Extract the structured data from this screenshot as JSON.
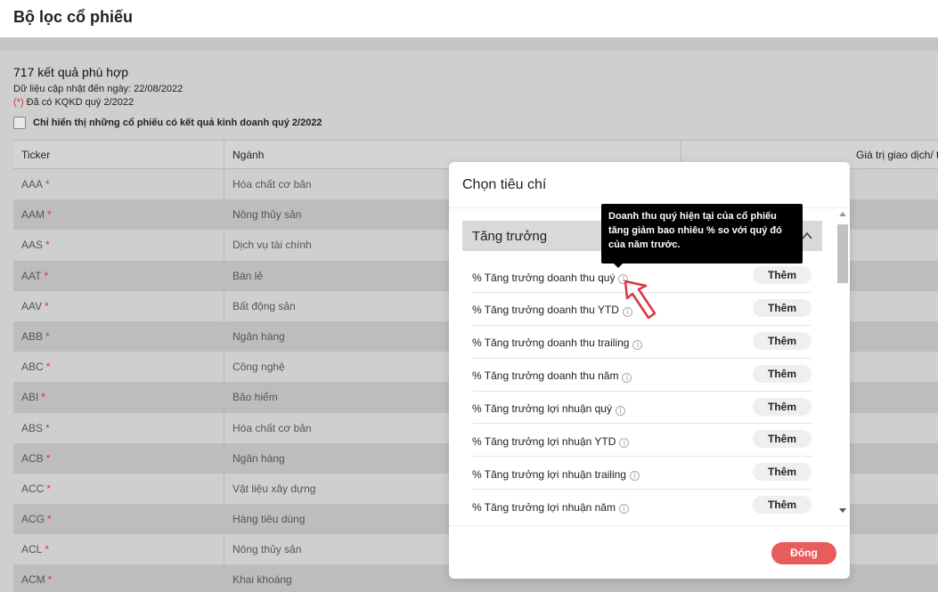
{
  "header": {
    "title": "Bộ lọc cổ phiếu"
  },
  "results": {
    "count_text": "717 kết quả phù hợp",
    "updated_text": "Dữ liệu cập nhật đến ngày: 22/08/2022",
    "note_star": "(*)",
    "note_text": " Đã có KQKD quý 2/2022",
    "filter_label": "Chỉ hiển thị những cổ phiếu có kết quả kinh doanh quý 2/2022"
  },
  "table": {
    "columns": {
      "ticker": "Ticker",
      "sector": "Ngành",
      "value": "Giá trị giao dịch/ t"
    },
    "rows": [
      {
        "ticker": "AAA",
        "sector": "Hóa chất cơ bản"
      },
      {
        "ticker": "AAM",
        "sector": "Nông thủy sản"
      },
      {
        "ticker": "AAS",
        "sector": "Dịch vụ tài chính"
      },
      {
        "ticker": "AAT",
        "sector": "Bán lẻ"
      },
      {
        "ticker": "AAV",
        "sector": "Bất động sản"
      },
      {
        "ticker": "ABB",
        "sector": "Ngân hàng"
      },
      {
        "ticker": "ABC",
        "sector": "Công nghệ"
      },
      {
        "ticker": "ABI",
        "sector": "Bảo hiểm"
      },
      {
        "ticker": "ABS",
        "sector": "Hóa chất cơ bản"
      },
      {
        "ticker": "ACB",
        "sector": "Ngân hàng"
      },
      {
        "ticker": "ACC",
        "sector": "Vật liệu xây dựng"
      },
      {
        "ticker": "ACG",
        "sector": "Hàng tiêu dùng"
      },
      {
        "ticker": "ACL",
        "sector": "Nông thủy sản"
      },
      {
        "ticker": "ACM",
        "sector": "Khai khoáng"
      }
    ],
    "star": "*"
  },
  "modal": {
    "title": "Chọn tiêu chí",
    "section_title": "Tăng trưởng",
    "add_label": "Thêm",
    "close_label": "Đóng",
    "criteria": [
      "% Tăng trưởng doanh thu quý",
      "% Tăng trưởng doanh thu YTD",
      "% Tăng trưởng doanh thu trailing",
      "% Tăng trưởng doanh thu năm",
      "% Tăng trưởng lợi nhuận quý",
      "% Tăng trưởng lợi nhuận YTD",
      "% Tăng trưởng lợi nhuận trailing",
      "% Tăng trưởng lợi nhuận năm"
    ]
  },
  "tooltip": {
    "text": "Doanh thu quý hiện tại của cổ phiếu tăng giảm bao nhiêu % so với quý đó của năm trước."
  },
  "icons": {
    "info": "info-icon",
    "collapse": "chevron-up-icon",
    "pointer": "arrow-pointer-icon"
  },
  "colors": {
    "accent": "#e85c5c",
    "star": "#d9363e"
  }
}
